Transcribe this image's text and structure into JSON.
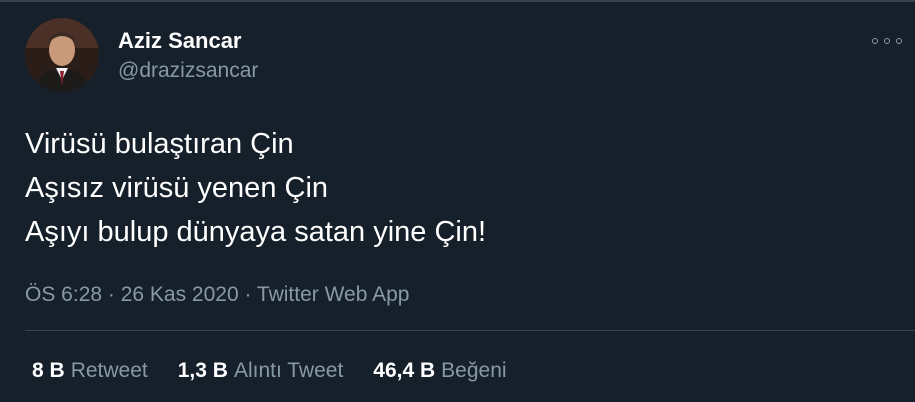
{
  "author": {
    "name": "Aziz Sancar",
    "handle": "@drazizsancar",
    "avatar_icon": "profile-photo"
  },
  "more_icon": "more-options-icon",
  "tweet": {
    "lines": [
      "Virüsü bulaştıran Çin",
      "Aşısız virüsü yenen Çin",
      "Aşıyı bulup dünyaya satan yine Çin!"
    ],
    "meta": "ÖS 6:28 · 26 Kas 2020 · Twitter Web App"
  },
  "stats": [
    {
      "count": "8 B",
      "label": "Retweet"
    },
    {
      "count": "1,3 B",
      "label": "Alıntı Tweet"
    },
    {
      "count": "46,4 B",
      "label": "Beğeni"
    }
  ],
  "colors": {
    "background": "#15202b",
    "secondary_text": "#8899a6",
    "border": "#38444d"
  }
}
